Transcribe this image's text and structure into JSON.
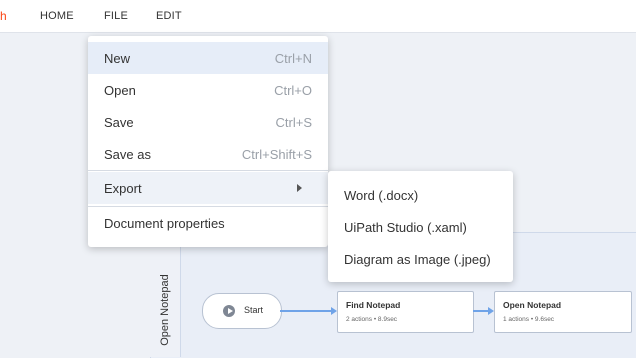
{
  "menubar": {
    "logo_fragment": "h",
    "items": [
      "HOME",
      "FILE",
      "EDIT"
    ]
  },
  "file_menu": {
    "items": [
      {
        "label": "New",
        "shortcut": "Ctrl+N"
      },
      {
        "label": "Open",
        "shortcut": "Ctrl+O"
      },
      {
        "label": "Save",
        "shortcut": "Ctrl+S"
      },
      {
        "label": "Save as",
        "shortcut": "Ctrl+Shift+S"
      }
    ],
    "export_label": "Export",
    "properties_label": "Document properties"
  },
  "export_submenu": {
    "items": [
      "Word (.docx)",
      "UiPath Studio (.xaml)",
      "Diagram as Image (.jpeg)"
    ]
  },
  "diagram": {
    "lane_label": "Open Notepad",
    "start_label": "Start",
    "activities": [
      {
        "title": "Find Notepad",
        "stats": "2 actions  •  8.9sec"
      },
      {
        "title": "Open Notepad",
        "stats": "1 actions  •  9.6sec"
      }
    ]
  },
  "colors": {
    "brand": "#fa4616",
    "highlight": "#e6edf8",
    "connector": "#6fa3e8"
  }
}
